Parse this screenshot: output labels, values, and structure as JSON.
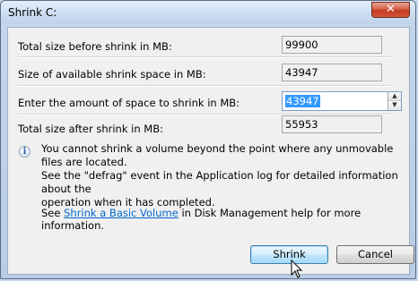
{
  "window": {
    "title": "Shrink C:",
    "close_glyph": "✕"
  },
  "fields": {
    "total_before": {
      "label": "Total size before shrink in MB:",
      "value": "99900"
    },
    "available": {
      "label": "Size of available shrink space in MB:",
      "value": "43947"
    },
    "amount": {
      "label": "Enter the amount of space to shrink in MB:",
      "value": "43947"
    },
    "total_after": {
      "label": "Total size after shrink in MB:",
      "value": "55953"
    }
  },
  "info": {
    "icon": "info-icon",
    "line1": "You cannot shrink a volume beyond the point where any unmovable files are located.",
    "line2": "See the \"defrag\" event in the Application log for detailed information about the",
    "line3": "operation when it has completed."
  },
  "help": {
    "prefix": "See ",
    "link": "Shrink a Basic Volume",
    "suffix": " in Disk Management help for more information."
  },
  "buttons": {
    "shrink": "Shrink",
    "cancel": "Cancel"
  },
  "colors": {
    "accent": "#3399ff",
    "link": "#0066cc",
    "close": "#c2391f"
  }
}
